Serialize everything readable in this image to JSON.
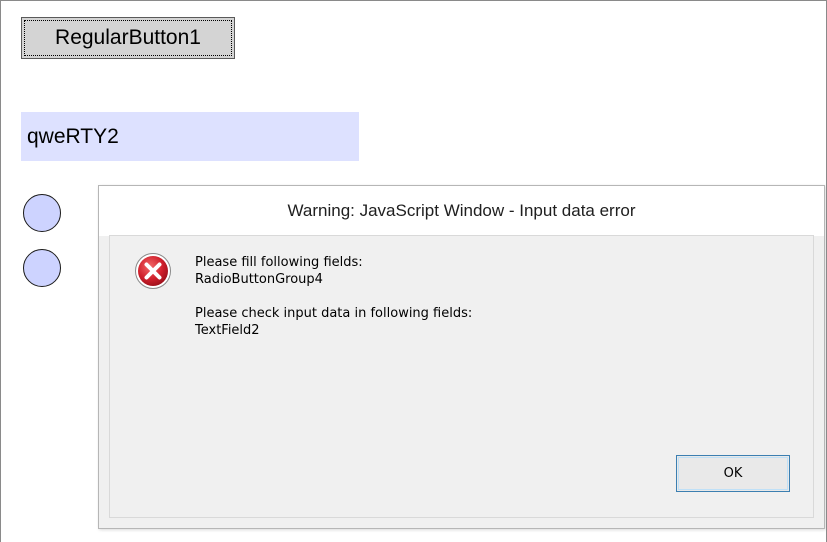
{
  "form": {
    "regular_button_label": "RegularButton1",
    "text_field_value": "qweRTY2"
  },
  "dialog": {
    "title": "Warning: JavaScript Window - Input data error",
    "icon": "error-icon",
    "messages": {
      "fill_heading": "Please fill following fields:",
      "fill_field": "RadioButtonGroup4",
      "check_heading": "Please check input data in following fields:",
      "check_field": "TextField2"
    },
    "ok_label": "OK"
  },
  "colors": {
    "text_field_bg": "#dde1ff",
    "radio_fill": "#cdd3ff",
    "error_red": "#c8102e",
    "ok_border": "#3c7fb1"
  }
}
